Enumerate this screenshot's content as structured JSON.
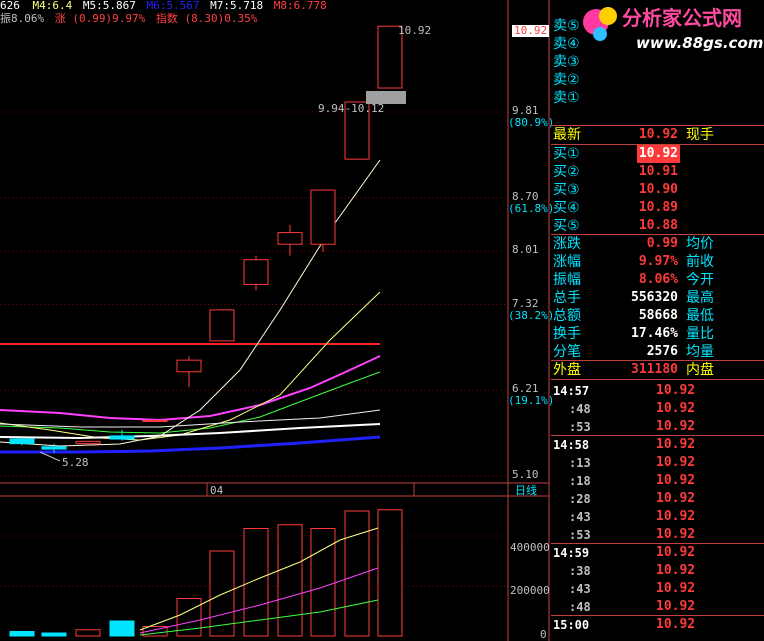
{
  "top_ma_bar": {
    "m3": "626",
    "m4": "M4:6.4",
    "m5": "M5:5.867",
    "m6": "M6:5.567",
    "m7": "M7:5.718",
    "m8": "M8:6.778"
  },
  "info_bar": {
    "amplitude": "振8.06%",
    "change_label": "涨",
    "change_value": "(0.99)9.97%",
    "index_label": "指数",
    "index_value": "(8.30)0.35%"
  },
  "logo": {
    "text": "分析家公式网",
    "url": "www.88gs.com"
  },
  "annotations": {
    "high_label": "10.92",
    "range_label": "9.94-10.12",
    "low_label": "5.28",
    "current_price_tag": "10.92"
  },
  "price_axis": [
    {
      "value": "10.92",
      "pct": "",
      "y": 10.92
    },
    {
      "value": "9.81",
      "pct": "(80.9%)",
      "y": 9.81
    },
    {
      "value": "8.70",
      "pct": "(61.8%)",
      "y": 8.7
    },
    {
      "value": "8.01",
      "pct": "",
      "y": 8.01
    },
    {
      "value": "7.32",
      "pct": "(38.2%)",
      "y": 7.32
    },
    {
      "value": "6.21",
      "pct": "(19.1%)",
      "y": 6.21
    },
    {
      "value": "5.10",
      "pct": "",
      "y": 5.1
    }
  ],
  "date_label": "04",
  "period_label": "日线",
  "volume_axis": [
    "400000",
    "200000",
    "0"
  ],
  "colors": {
    "up": "#ff3a3a",
    "down": "#00e4ff",
    "ma_white": "#ffffff",
    "ma_yellow": "#ffff80",
    "ma_magenta": "#ff40ff",
    "ma_green": "#40ff40",
    "ma_blue": "#2020ff",
    "ma_red": "#ff2020",
    "label_cyan": "#00e4ff",
    "grid": "#800000"
  },
  "chart_data": {
    "type": "candlestick",
    "candles": [
      {
        "o": 5.58,
        "h": 5.6,
        "l": 5.5,
        "c": 5.52
      },
      {
        "o": 5.48,
        "h": 5.52,
        "l": 5.4,
        "c": 5.45
      },
      {
        "o": 5.52,
        "h": 5.56,
        "l": 5.5,
        "c": 5.55
      },
      {
        "o": 5.62,
        "h": 5.7,
        "l": 5.56,
        "c": 5.58
      },
      {
        "o": 5.82,
        "h": 5.84,
        "l": 5.8,
        "c": 5.82
      },
      {
        "o": 6.45,
        "h": 6.65,
        "l": 6.25,
        "c": 6.6
      },
      {
        "o": 6.85,
        "h": 7.25,
        "l": 6.85,
        "c": 7.25
      },
      {
        "o": 7.58,
        "h": 7.95,
        "l": 7.5,
        "c": 7.9
      },
      {
        "o": 8.1,
        "h": 8.35,
        "l": 7.95,
        "c": 8.25
      },
      {
        "o": 8.1,
        "h": 8.8,
        "l": 8.0,
        "c": 8.8
      },
      {
        "o": 9.2,
        "h": 9.94,
        "l": 9.2,
        "c": 9.94
      },
      {
        "o": 10.12,
        "h": 10.92,
        "l": 10.12,
        "c": 10.92
      }
    ],
    "volume": [
      18000,
      12000,
      25000,
      60000,
      38000,
      150000,
      340000,
      430000,
      445000,
      430000,
      500000,
      505000
    ],
    "ylim": [
      5.05,
      11.0
    ],
    "vol_max": 560000
  },
  "order_book": {
    "sell": [
      {
        "label": "卖⑤",
        "price": "",
        "vol": ""
      },
      {
        "label": "卖④",
        "price": "",
        "vol": ""
      },
      {
        "label": "卖③",
        "price": "",
        "vol": ""
      },
      {
        "label": "卖②",
        "price": "",
        "vol": ""
      },
      {
        "label": "卖①",
        "price": "",
        "vol": ""
      }
    ],
    "latest_label": "最新",
    "latest_value": "10.92",
    "latest_right": "现手",
    "buy": [
      {
        "label": "买①",
        "price": "10.92"
      },
      {
        "label": "买②",
        "price": "10.91"
      },
      {
        "label": "买③",
        "price": "10.90"
      },
      {
        "label": "买④",
        "price": "10.89"
      },
      {
        "label": "买⑤",
        "price": "10.88"
      }
    ],
    "stats": [
      {
        "label": "涨跌",
        "value": "0.99",
        "right": "均价"
      },
      {
        "label": "涨幅",
        "value": "9.97%",
        "right": "前收"
      },
      {
        "label": "振幅",
        "value": "8.06%",
        "right": "今开"
      },
      {
        "label": "总手",
        "value": "556320",
        "right": "最高"
      },
      {
        "label": "总额",
        "value": "58668",
        "right": "最低"
      },
      {
        "label": "换手",
        "value": "17.46%",
        "right": "量比"
      },
      {
        "label": "分笔",
        "value": "2576",
        "right": "均量"
      }
    ],
    "outer_label": "外盘",
    "outer_value": "311180",
    "inner_label": "内盘"
  },
  "ticks": [
    {
      "time": "14:57",
      "price": "10.92"
    },
    {
      "time": ":48",
      "price": "10.92"
    },
    {
      "time": ":53",
      "price": "10.92"
    },
    {
      "time": "14:58",
      "price": "10.92"
    },
    {
      "time": ":13",
      "price": "10.92"
    },
    {
      "time": ":18",
      "price": "10.92"
    },
    {
      "time": ":28",
      "price": "10.92"
    },
    {
      "time": ":43",
      "price": "10.92"
    },
    {
      "time": ":53",
      "price": "10.92"
    },
    {
      "time": "14:59",
      "price": "10.92"
    },
    {
      "time": ":38",
      "price": "10.92"
    },
    {
      "time": ":43",
      "price": "10.92"
    },
    {
      "time": ":48",
      "price": "10.92"
    },
    {
      "time": "15:00",
      "price": "10.92"
    }
  ]
}
